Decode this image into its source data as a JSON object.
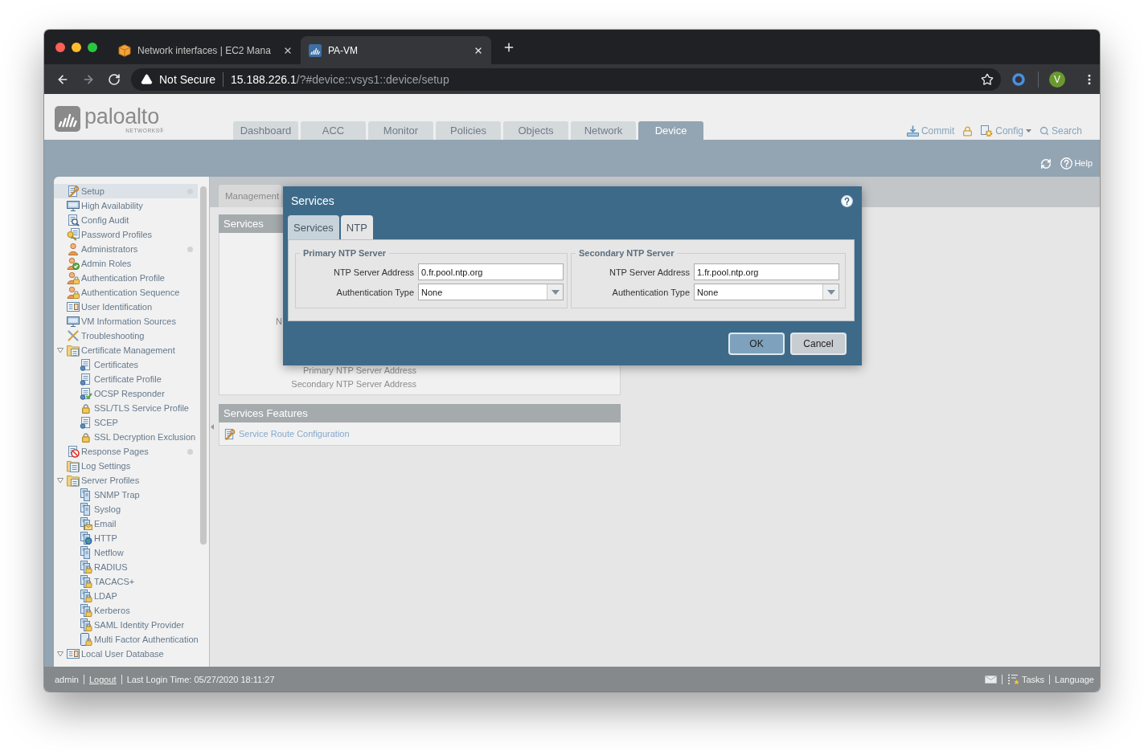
{
  "browser": {
    "tabs": [
      {
        "title": "Network interfaces | EC2 Mana",
        "selected": false
      },
      {
        "title": "PA-VM",
        "selected": true
      }
    ],
    "address_bar": {
      "security": "Not Secure",
      "host": "15.188.226.1",
      "path": "/?#device::vsys1::device/setup"
    },
    "profile_initial": "V"
  },
  "header": {
    "logo": {
      "name": "paloalto",
      "tagline": "NETWORKS®"
    },
    "tabs": [
      {
        "label": "Dashboard",
        "selected": false
      },
      {
        "label": "ACC",
        "selected": false
      },
      {
        "label": "Monitor",
        "selected": false
      },
      {
        "label": "Policies",
        "selected": false
      },
      {
        "label": "Objects",
        "selected": false
      },
      {
        "label": "Network",
        "selected": false
      },
      {
        "label": "Device",
        "selected": true
      }
    ],
    "actions": [
      {
        "kind": "commit",
        "label": "Commit"
      },
      {
        "kind": "lock"
      },
      {
        "kind": "config",
        "label": "Config"
      },
      {
        "kind": "search",
        "label": "Search"
      }
    ],
    "help": "Help"
  },
  "sidebar": {
    "items": [
      {
        "label": "Setup",
        "selected": true,
        "indicator": true
      },
      {
        "label": "High Availability",
        "selected": false,
        "indicator": false
      },
      {
        "label": "Config Audit",
        "selected": false,
        "indicator": false
      },
      {
        "label": "Password Profiles",
        "selected": false,
        "indicator": false
      },
      {
        "label": "Administrators",
        "selected": false,
        "indicator": true
      },
      {
        "label": "Admin Roles",
        "selected": false,
        "indicator": false
      },
      {
        "label": "Authentication Profile",
        "selected": false,
        "indicator": false
      },
      {
        "label": "Authentication Sequence",
        "selected": false,
        "indicator": false
      },
      {
        "label": "User Identification",
        "selected": false,
        "indicator": false
      },
      {
        "label": "VM Information Sources",
        "selected": false,
        "indicator": false
      },
      {
        "label": "Troubleshooting",
        "selected": false,
        "indicator": false
      },
      {
        "label": "Certificate Management",
        "selected": false,
        "indicator": false,
        "expanded": true,
        "children": [
          {
            "label": "Certificates",
            "selected": false,
            "indicator": false
          },
          {
            "label": "Certificate Profile",
            "selected": false,
            "indicator": false
          },
          {
            "label": "OCSP Responder",
            "selected": false,
            "indicator": false
          },
          {
            "label": "SSL/TLS Service Profile",
            "selected": false,
            "indicator": false
          },
          {
            "label": "SCEP",
            "selected": false,
            "indicator": false
          },
          {
            "label": "SSL Decryption Exclusion",
            "selected": false,
            "indicator": false
          }
        ]
      },
      {
        "label": "Response Pages",
        "selected": false,
        "indicator": true
      },
      {
        "label": "Log Settings",
        "selected": false,
        "indicator": false
      },
      {
        "label": "Server Profiles",
        "selected": false,
        "indicator": false,
        "expanded": true,
        "children": [
          {
            "label": "SNMP Trap",
            "selected": false,
            "indicator": false
          },
          {
            "label": "Syslog",
            "selected": false,
            "indicator": false
          },
          {
            "label": "Email",
            "selected": false,
            "indicator": false
          },
          {
            "label": "HTTP",
            "selected": false,
            "indicator": false
          },
          {
            "label": "Netflow",
            "selected": false,
            "indicator": false
          },
          {
            "label": "RADIUS",
            "selected": false,
            "indicator": false
          },
          {
            "label": "TACACS+",
            "selected": false,
            "indicator": false
          },
          {
            "label": "LDAP",
            "selected": false,
            "indicator": false
          },
          {
            "label": "Kerberos",
            "selected": false,
            "indicator": false
          },
          {
            "label": "SAML Identity Provider",
            "selected": false,
            "indicator": false
          },
          {
            "label": "Multi Factor Authentication",
            "selected": false,
            "indicator": false
          }
        ]
      },
      {
        "label": "Local User Database",
        "selected": false,
        "indicator": false,
        "expanded": true
      }
    ]
  },
  "page_tabs": [
    {
      "label": "Management",
      "selected": false
    }
  ],
  "services_panel": {
    "title": "Services",
    "labels": [
      "N",
      "Primary NTP Server Address",
      "Secondary NTP Server Address"
    ]
  },
  "features_panel": {
    "title": "Services Features",
    "links": [
      "Service Route Configuration"
    ]
  },
  "dialog": {
    "title": "Services",
    "tabs": [
      {
        "label": "Services",
        "selected": false
      },
      {
        "label": "NTP",
        "selected": true
      }
    ],
    "groups": [
      {
        "legend": "Primary NTP Server",
        "fields": [
          {
            "kind": "text",
            "label": "NTP Server Address",
            "value": "0.fr.pool.ntp.org"
          },
          {
            "kind": "select",
            "label": "Authentication Type",
            "value": "None"
          }
        ]
      },
      {
        "legend": "Secondary NTP Server",
        "fields": [
          {
            "kind": "text",
            "label": "NTP Server Address",
            "value": "1.fr.pool.ntp.org"
          },
          {
            "kind": "select",
            "label": "Authentication Type",
            "value": "None"
          }
        ]
      }
    ],
    "buttons": [
      {
        "label": "OK",
        "primary": true
      },
      {
        "label": "Cancel",
        "primary": false
      }
    ]
  },
  "status_bar": {
    "user": "admin",
    "logout": "Logout",
    "last_login": "Last Login Time: 05/27/2020 18:11:27",
    "items": [
      {
        "kind": "mail"
      },
      {
        "kind": "tasks",
        "label": "Tasks"
      },
      {
        "kind": "link",
        "label": "Language"
      }
    ]
  }
}
